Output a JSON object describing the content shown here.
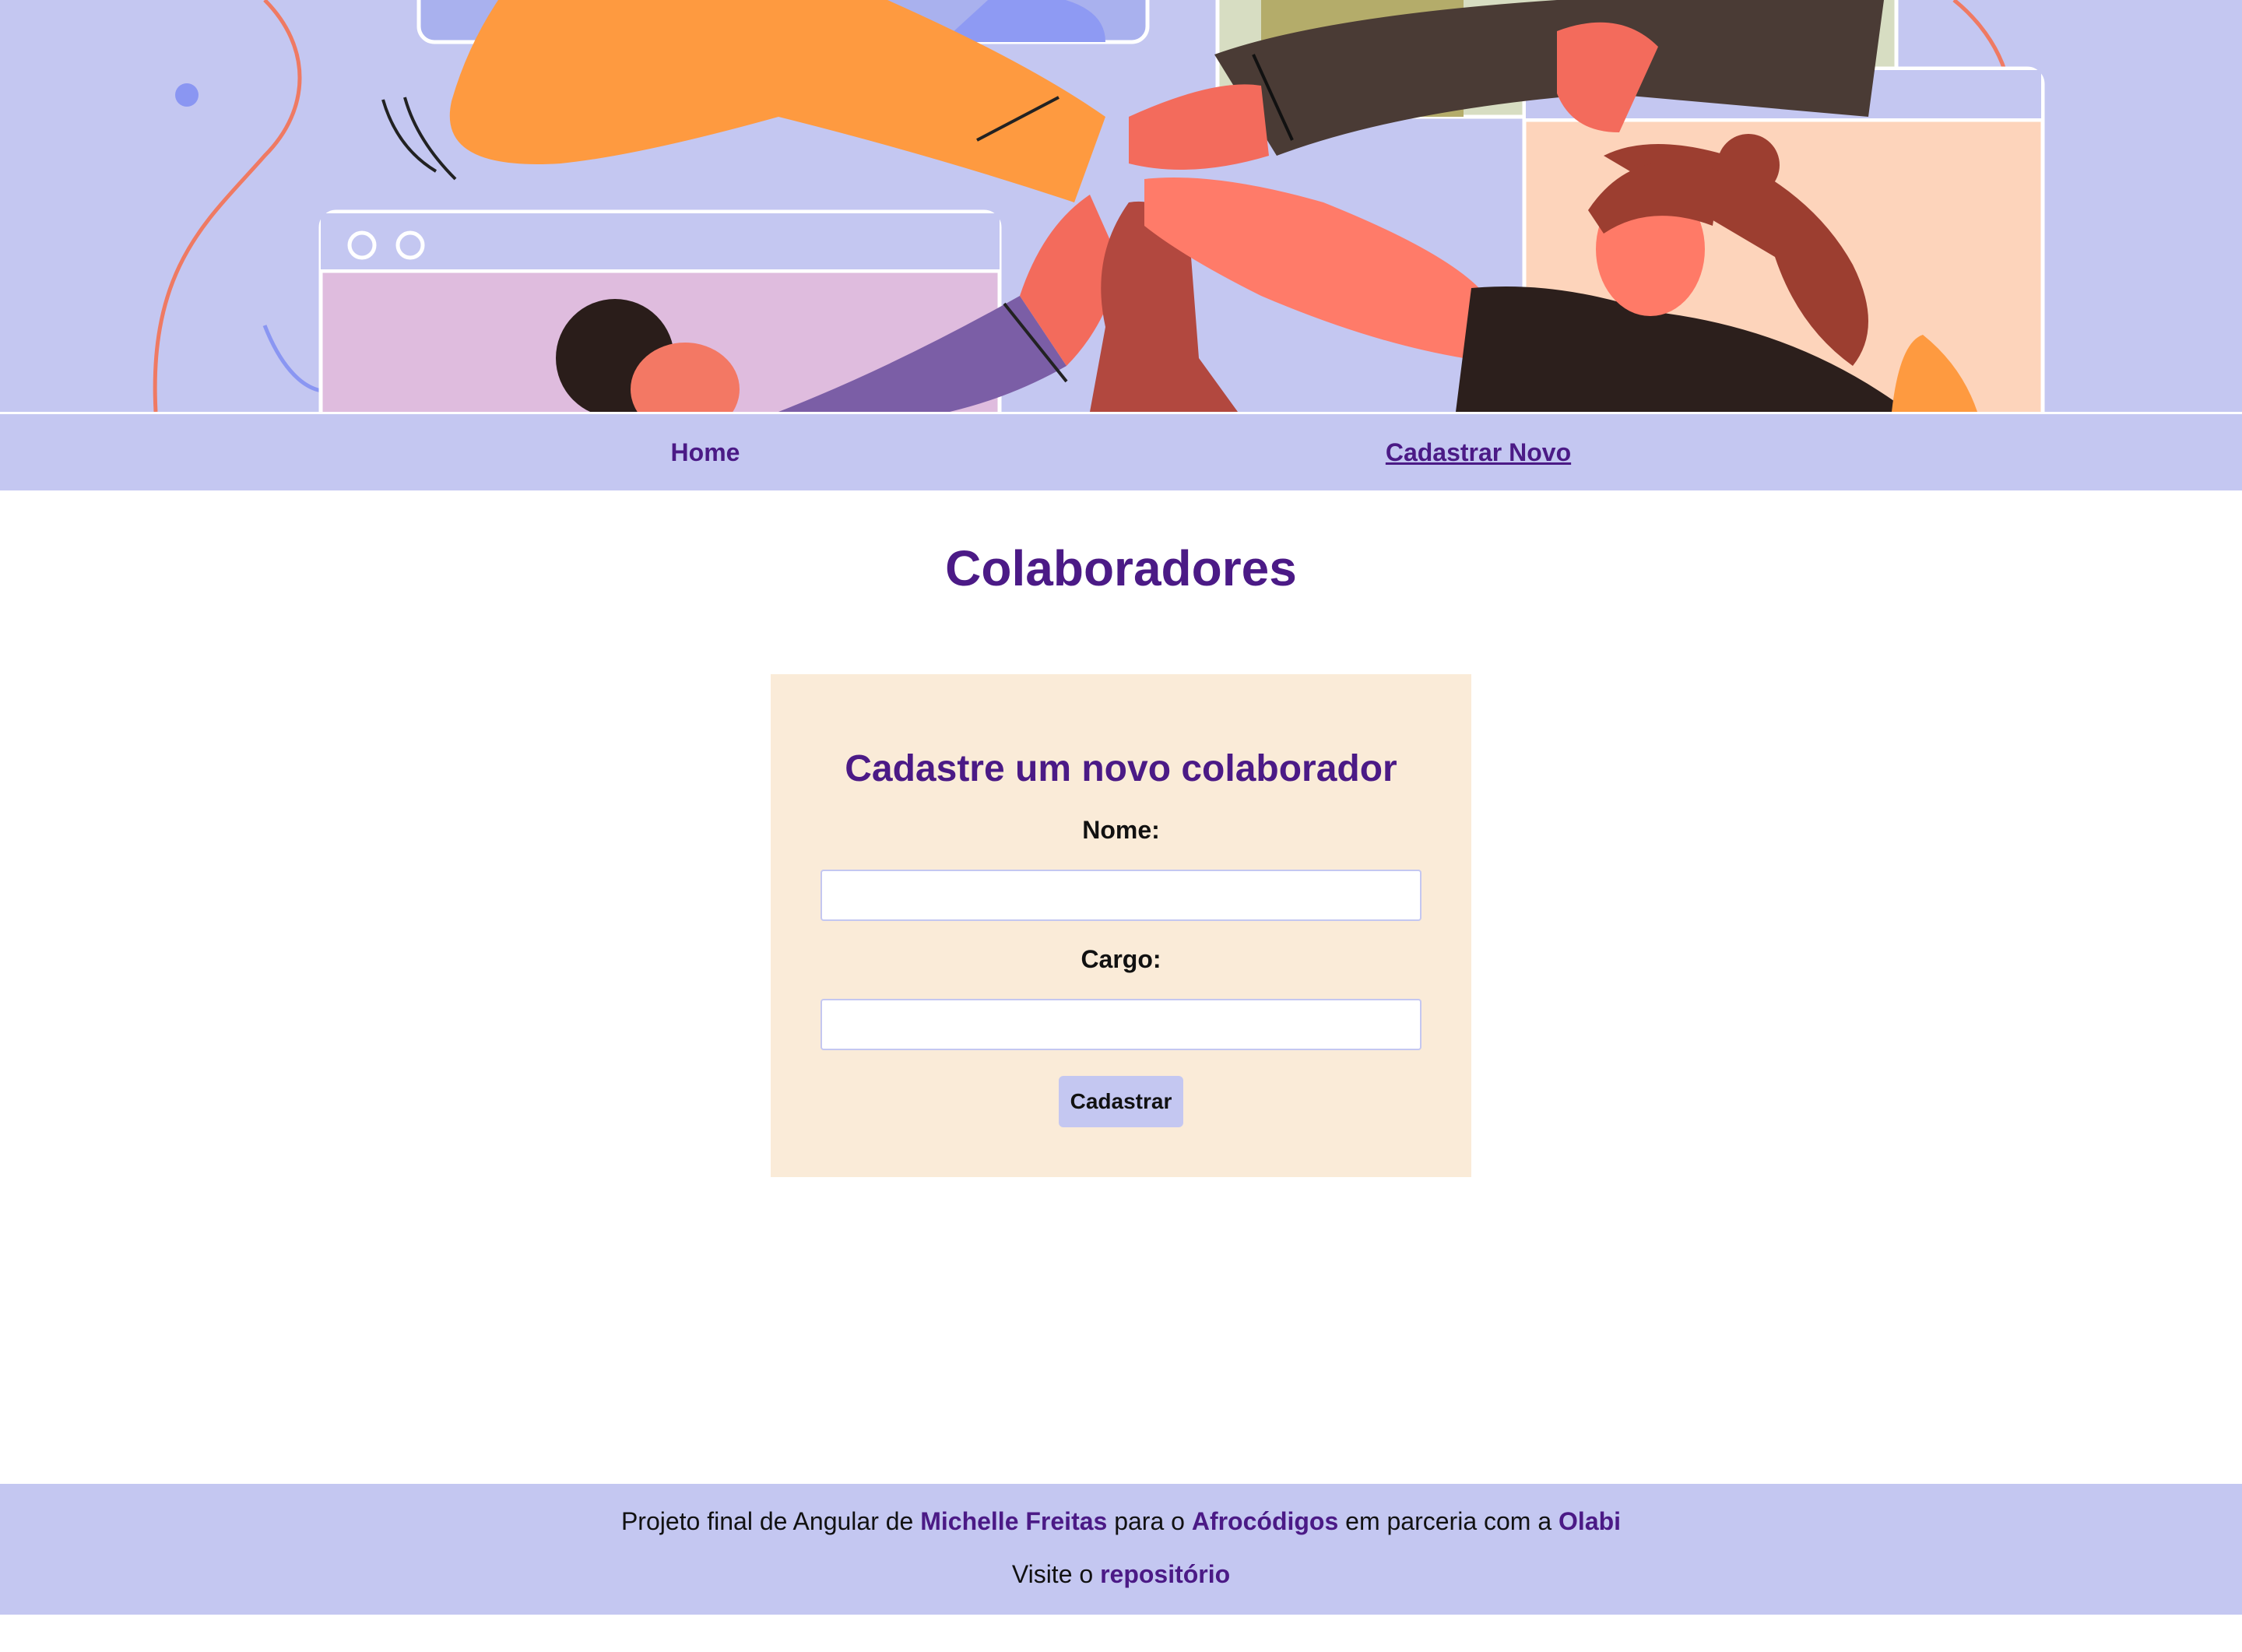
{
  "colors": {
    "accent_purple": "#4b1a86",
    "lavender": "#c4c7f1",
    "card_beige": "#faebd8",
    "white": "#ffffff"
  },
  "banner": {
    "illustration": "team-high-five-illustration"
  },
  "nav": {
    "home": "Home",
    "cadastrar_novo": "Cadastrar Novo"
  },
  "main": {
    "title": "Colaboradores"
  },
  "form": {
    "title": "Cadastre um novo colaborador",
    "nome_label": "Nome:",
    "nome_value": "",
    "cargo_label": "Cargo:",
    "cargo_value": "",
    "submit": "Cadastrar"
  },
  "footer": {
    "line1_prefix": "Projeto final de Angular de ",
    "author": "Michelle Freitas",
    "line1_mid1": " para o ",
    "org1": "Afrocódigos",
    "line1_mid2": " em parceria com a ",
    "org2": "Olabi",
    "line2_prefix": "Visite o ",
    "repo_link": "repositório"
  }
}
